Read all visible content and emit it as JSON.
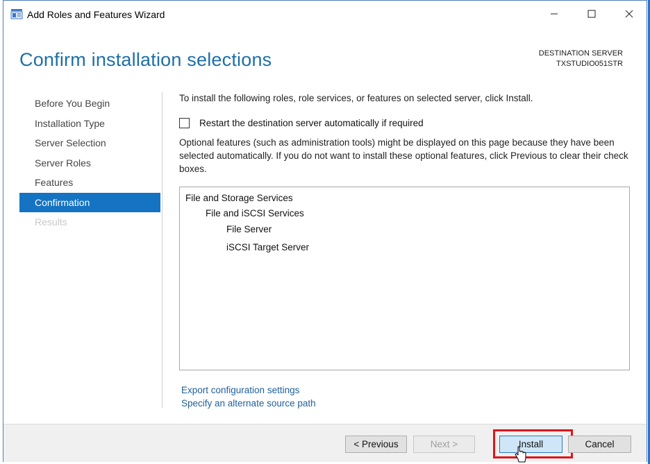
{
  "window": {
    "title": "Add Roles and Features Wizard",
    "controls": {
      "minimize": "minimize",
      "maximize": "maximize",
      "close": "close"
    }
  },
  "header": {
    "title": "Confirm installation selections",
    "destination_label": "DESTINATION SERVER",
    "destination_server": "TXSTUDIO051STR"
  },
  "nav": {
    "items": [
      {
        "label": "Before You Begin",
        "state": "normal"
      },
      {
        "label": "Installation Type",
        "state": "normal"
      },
      {
        "label": "Server Selection",
        "state": "normal"
      },
      {
        "label": "Server Roles",
        "state": "normal"
      },
      {
        "label": "Features",
        "state": "normal"
      },
      {
        "label": "Confirmation",
        "state": "active"
      },
      {
        "label": "Results",
        "state": "disabled"
      }
    ]
  },
  "main": {
    "intro": "To install the following roles, role services, or features on selected server, click Install.",
    "restart_checkbox": {
      "label": "Restart the destination server automatically if required",
      "checked": false
    },
    "optional_note": "Optional features (such as administration tools) might be displayed on this page because they have been selected automatically. If you do not want to install these optional features, click Previous to clear their check boxes.",
    "selections": [
      {
        "label": "File and Storage Services",
        "level": 0
      },
      {
        "label": "File and iSCSI Services",
        "level": 1
      },
      {
        "label": "File Server",
        "level": 2
      },
      {
        "label": "iSCSI Target Server",
        "level": 2
      }
    ],
    "links": {
      "export": "Export configuration settings",
      "alternate_source": "Specify an alternate source path"
    }
  },
  "footer": {
    "previous": "< Previous",
    "next": "Next >",
    "install": "Install",
    "cancel": "Cancel"
  },
  "colors": {
    "accent": "#1573c3",
    "title_blue": "#1e6fa8",
    "link": "#1f5f9a",
    "highlight_outline": "#e0141a"
  }
}
